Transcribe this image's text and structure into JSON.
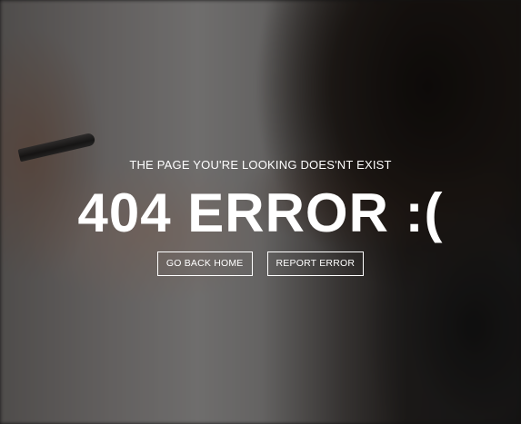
{
  "error_page": {
    "subtitle": "THE PAGE YOU'RE LOOKING DOES'NT EXIST",
    "headline": "404 ERROR :(",
    "buttons": {
      "home_label": "GO BACK HOME",
      "report_label": "REPORT ERROR"
    }
  },
  "colors": {
    "text": "#ffffff",
    "button_border": "#ffffff"
  }
}
